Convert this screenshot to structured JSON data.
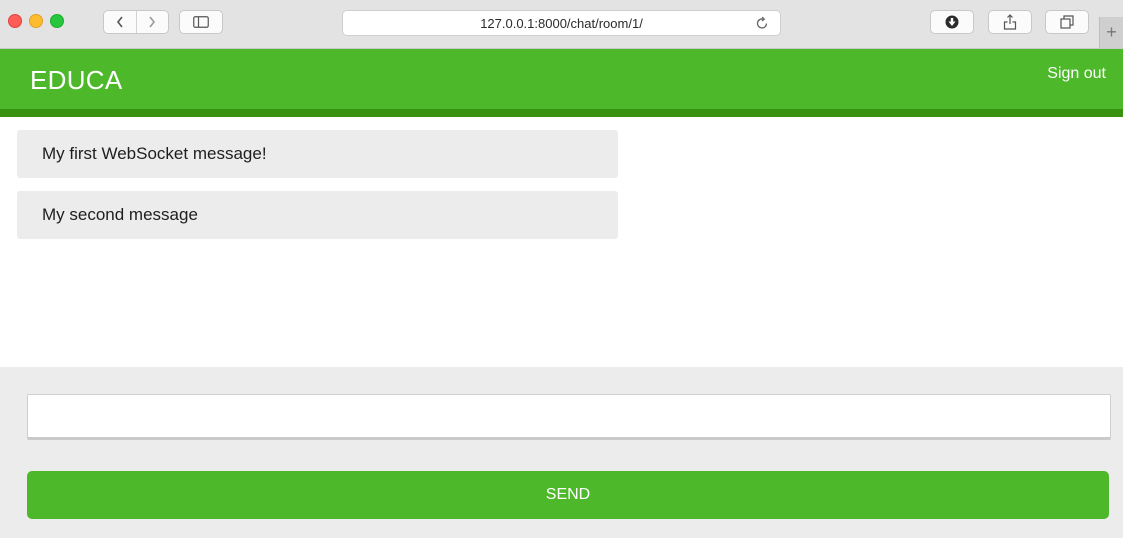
{
  "browser": {
    "url": "127.0.0.1:8000/chat/room/1/",
    "icons": [
      "back-icon",
      "forward-icon",
      "sidebar-icon",
      "reload-icon",
      "download-icon",
      "share-icon",
      "tabs-icon",
      "plus-icon"
    ],
    "plus_label": "+"
  },
  "header": {
    "logo": "EDUCA",
    "signout_label": "Sign out",
    "colors": {
      "bar": "#4cb82a",
      "stripe": "#39920f"
    }
  },
  "chat": {
    "messages": [
      {
        "text": "My first WebSocket message!"
      },
      {
        "text": "My second message"
      }
    ]
  },
  "composer": {
    "input_value": "",
    "send_label": "SEND",
    "colors": {
      "button": "#4cb82a",
      "background": "#ececec"
    }
  }
}
